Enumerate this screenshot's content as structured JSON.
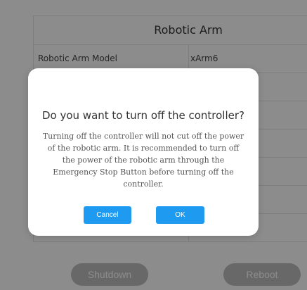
{
  "panel": {
    "title": "Robotic Arm",
    "rows": [
      {
        "key": "Robotic Arm Model",
        "value": "xArm6"
      },
      {
        "key": "",
        "value": ""
      },
      {
        "key": "",
        "value": ""
      },
      {
        "key": "",
        "value": ""
      },
      {
        "key": "",
        "value": ""
      },
      {
        "key": "",
        "value": ""
      },
      {
        "key": "",
        "value": ""
      }
    ]
  },
  "footer": {
    "shutdown_label": "Shutdown",
    "reboot_label": "Reboot"
  },
  "dialog": {
    "title": "Do you want to turn off the controller?",
    "message": "Turning off the controller will not cut off the power of the robotic arm. It is recommended to turn off the power of the robotic arm through the Emergency Stop Button before turning off the controller.",
    "cancel_label": "Cancel",
    "ok_label": "OK"
  },
  "colors": {
    "primary_button": "#1e9bf0",
    "disabled_button": "#bdbdbd",
    "overlay": "rgba(0,0,0,0.45)"
  }
}
